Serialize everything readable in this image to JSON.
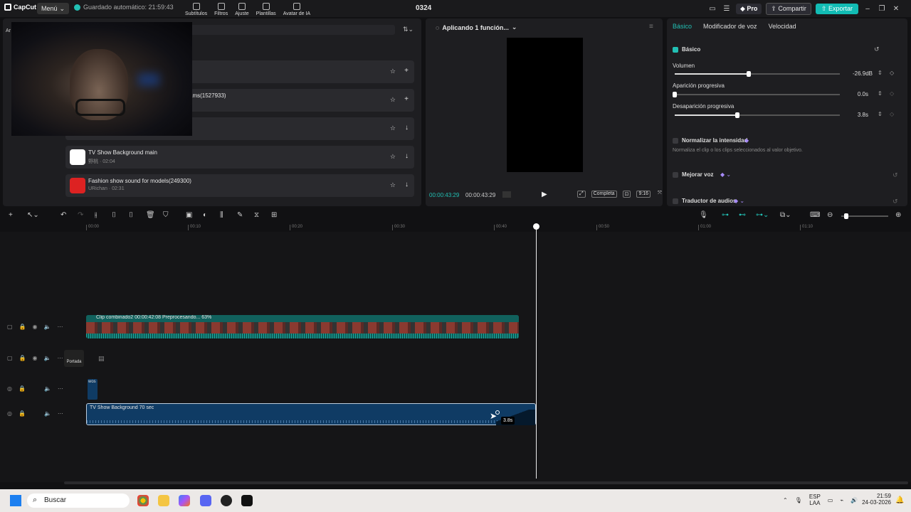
{
  "titlebar": {
    "app": "CapCut",
    "menu": "Menú",
    "autosave": "Guardado automático: 21:59:43",
    "project": "0324",
    "pro": "Pro",
    "share": "Compartir",
    "export": "Exportar"
  },
  "media": {
    "tabs": [
      "Subtítulos",
      "Filtros",
      "Ajuste",
      "Plantillas",
      "Avatar de IA"
    ],
    "left_label": "Ar",
    "items": [
      {
        "name": "",
        "sub": "",
        "action": "+"
      },
      {
        "name": "ams(1527933)",
        "sub": "",
        "action": "+"
      },
      {
        "name": "",
        "sub": "",
        "action": "↓"
      },
      {
        "name": "TV Show Background main",
        "sub": "野桃 · 02:04",
        "action": "↓"
      },
      {
        "name": "Fashion show sound for models(249300)",
        "sub": "URichan · 02:31",
        "action": "↓"
      }
    ]
  },
  "preview": {
    "title": "Aplicando 1 función...",
    "timecode_current": "00:00:43:29",
    "timecode_total": "00:00:43:29",
    "quality": "Completa",
    "ratio": "9:16"
  },
  "props": {
    "tabs": [
      "Básico",
      "Modificador de voz",
      "Velocidad"
    ],
    "section": "Básico",
    "volume_label": "Volumen",
    "volume_value": "-26.9dB",
    "volume_level": 0.45,
    "fadein_label": "Aparición progresiva",
    "fadein_value": "0.0s",
    "fadein_level": 0.0,
    "fadeout_label": "Desaparición progresiva",
    "fadeout_value": "3.8s",
    "fadeout_level": 0.38,
    "normalize_label": "Normalizar la intensidad",
    "normalize_desc": "Normaliza el clip o los clips seleccionados al valor objetivo.",
    "enhance_label": "Mejorar voz",
    "translate_label": "Traductor de audios"
  },
  "timeline": {
    "ruler": [
      "00:00",
      "00:10",
      "00:20",
      "00:30",
      "00:40",
      "00:50",
      "01:00",
      "01:10"
    ],
    "clip_main": "Clip combinado2  00:00:42:08  Preprocesando... 63%",
    "cover_label": "Portada",
    "small_clip": "wos",
    "audio_clip": "TV Show Background 70 sec",
    "tooltip": "3.8s"
  },
  "taskbar": {
    "search": "Buscar",
    "lang": "ESP",
    "lang2": "LAA",
    "time": "21:59",
    "date": "24-03-2026"
  }
}
